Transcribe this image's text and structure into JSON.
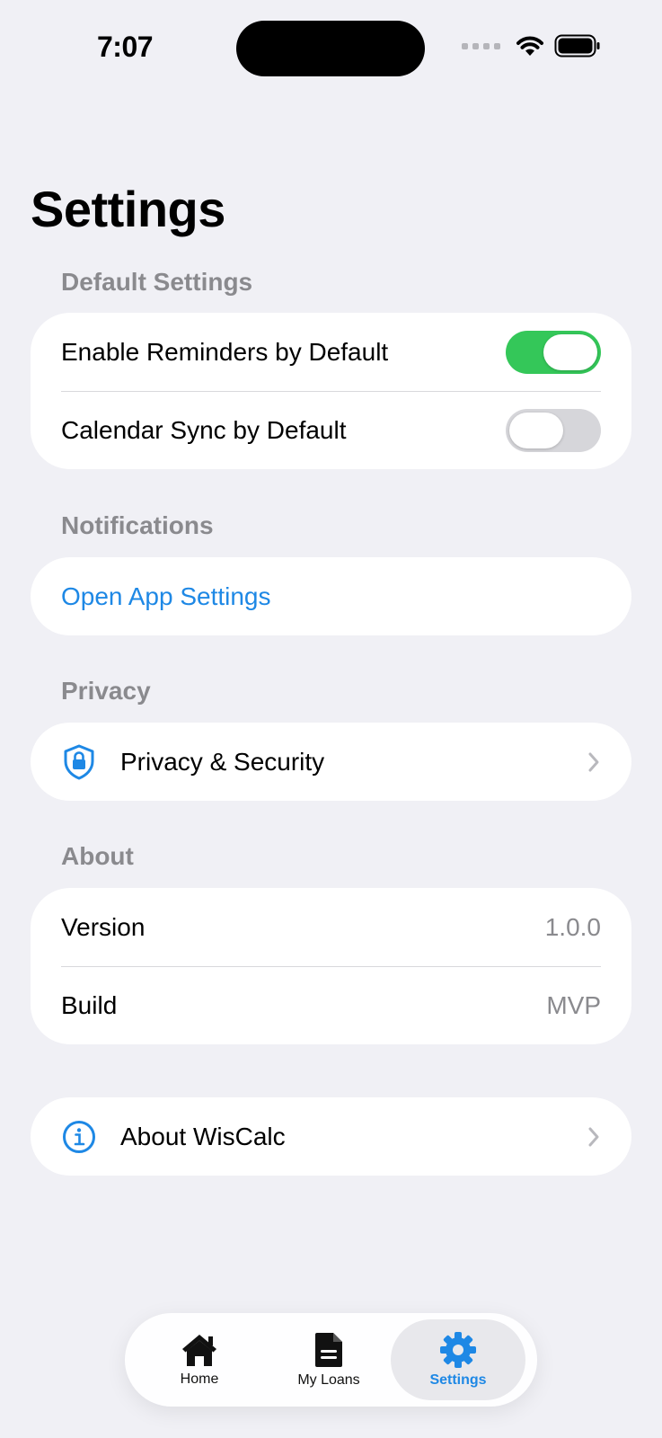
{
  "status_bar": {
    "time": "7:07"
  },
  "page": {
    "title": "Settings"
  },
  "default_settings": {
    "header": "Default Settings",
    "rows": [
      {
        "label": "Enable Reminders by Default",
        "enabled": true
      },
      {
        "label": "Calendar Sync by Default",
        "enabled": false
      }
    ]
  },
  "notifications": {
    "header": "Notifications",
    "open_app_settings_label": "Open App Settings"
  },
  "privacy": {
    "header": "Privacy",
    "item_label": "Privacy & Security",
    "item_icon": "shield-lock-icon"
  },
  "about": {
    "header": "About",
    "version_label": "Version",
    "version_value": "1.0.0",
    "build_label": "Build",
    "build_value": "MVP"
  },
  "about_app": {
    "label": "About WisCalc",
    "icon": "info-icon"
  },
  "tab_bar": {
    "tabs": [
      {
        "label": "Home",
        "icon": "home-icon",
        "active": false
      },
      {
        "label": "My Loans",
        "icon": "document-icon",
        "active": false
      },
      {
        "label": "Settings",
        "icon": "gear-icon",
        "active": true
      }
    ]
  },
  "colors": {
    "accent": "#1e88e5",
    "toggle_on": "#34c759",
    "background": "#f0f0f5"
  }
}
